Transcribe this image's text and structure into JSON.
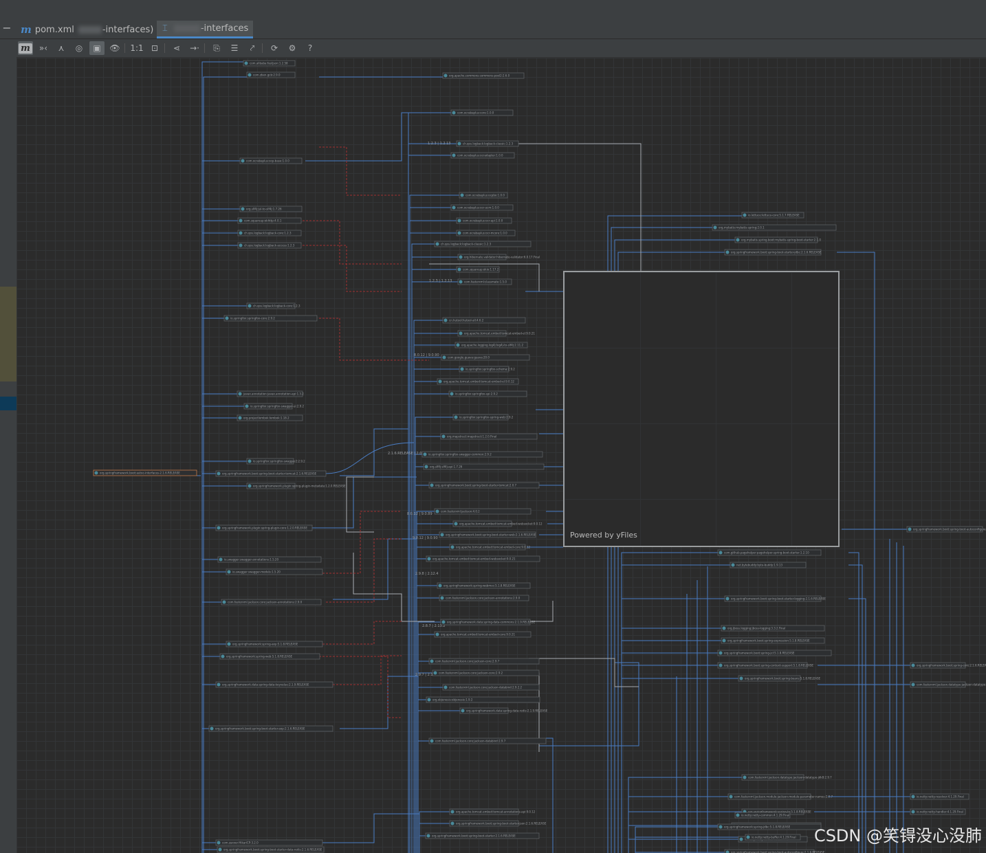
{
  "tabs": [
    {
      "label": "pom.xml",
      "label_suffix": "-interfaces)",
      "icon": "maven-m-icon"
    },
    {
      "label": "-interfaces",
      "icon": "diagram-icon"
    }
  ],
  "toolbar": [
    {
      "name": "show-maven-button",
      "icon": "m",
      "active": true
    },
    {
      "name": "collapse-button",
      "icon": "»‹"
    },
    {
      "name": "hierarchy-button",
      "icon": "⋏"
    },
    {
      "name": "highlight-button",
      "icon": "◎"
    },
    {
      "name": "fit-content-button",
      "icon": "▣",
      "active": true
    },
    {
      "name": "show-button",
      "icon": "👁"
    },
    {
      "name": "actual-size-button",
      "icon": "1:1"
    },
    {
      "name": "fit-window-button",
      "icon": "⊡"
    },
    {
      "name": "layout-button",
      "icon": "⋖"
    },
    {
      "name": "route-edges-button",
      "icon": "→·"
    },
    {
      "name": "copy-button",
      "icon": "⎘"
    },
    {
      "name": "edit-button",
      "icon": "☰"
    },
    {
      "name": "export-button",
      "icon": "⤤"
    },
    {
      "name": "refresh-button",
      "icon": "⟳"
    },
    {
      "name": "settings-button",
      "icon": "⚙"
    },
    {
      "name": "help-button",
      "icon": "?"
    }
  ],
  "overview": {
    "powered_by": "Powered by yFiles"
  },
  "edge_labels": [
    "1.2.3 | 1.2.13",
    "1.2.3 | 1.2.13",
    "8.0.12 | 9.0.90",
    "2.1.6.RELEASE | 2.0.7",
    "8.0.12 | 9.0.89",
    "9.0.12 | 9.0.90",
    "2.9.8 | 2.12.4",
    "2.8.7 | 2.13.2",
    "2.9.7 | 2.12.2"
  ],
  "nodes": [
    {
      "id": "root",
      "label": "org.springframework.boot:autoc-interfaces-2.1.6.RELEASE",
      "root": true
    },
    {
      "id": "n1",
      "label": "com.alibaba:fastjson:1.2.58"
    },
    {
      "id": "n2",
      "label": "com.zben.gcb:2.9.0"
    },
    {
      "id": "n3",
      "label": "org.apache.commons:commons-pool2:2.6.0"
    },
    {
      "id": "n4",
      "label": "com.ocrabaplus:ocp-base:1.0.0"
    },
    {
      "id": "n5",
      "label": "com.ocrabaplus:core:1.0.0"
    },
    {
      "id": "n6",
      "label": "ch.qos.logback:logback-classic:1.2.3"
    },
    {
      "id": "n7",
      "label": "com.ocrabaplus:ocradapter:1.0.0"
    },
    {
      "id": "n8",
      "label": "com.ocrabaplus:ocpbo:1.0.0"
    },
    {
      "id": "n9",
      "label": "org.slf4j:jul-to-slf4j:1.7.26"
    },
    {
      "id": "n10",
      "label": "com.ocrabaplus:ocr-ucm:1.0.0"
    },
    {
      "id": "n11",
      "label": "com.ocrabaplus:ocr-api:1.0.0"
    },
    {
      "id": "n12",
      "label": "com.ocrabaplus:ocr-mcore:1.0.0"
    },
    {
      "id": "n13",
      "label": "com.squareup:okhttp:4.0.1"
    },
    {
      "id": "n14",
      "label": "ch.qos.logback:logback-core:1.2.3"
    },
    {
      "id": "n15",
      "label": "ch.qos.logback:logback-access:1.2.3"
    },
    {
      "id": "n16",
      "label": "ch.qos.logback:logback-classic:1.2.3"
    },
    {
      "id": "n17",
      "label": "org.hibernate.validator:hibernate-validator:6.0.17.Final"
    },
    {
      "id": "n18",
      "label": "com.squareup:okio:1.17.2"
    },
    {
      "id": "n19",
      "label": "com.fasterxml:classmate:1.5.0"
    },
    {
      "id": "n20",
      "label": "ch.qos.logback:logback-core:1.2.3"
    },
    {
      "id": "n21",
      "label": "io.springfox:springfox-core:2.9.2"
    },
    {
      "id": "n22",
      "label": "cn.hutool:hutool-all:4.6.2"
    },
    {
      "id": "n23",
      "label": "org.apache.tomcat.embed:tomcat-embed-el:9.0.21"
    },
    {
      "id": "n24",
      "label": "org.apache.logging.log4j:log4j-to-slf4j:2.11.2"
    },
    {
      "id": "n25",
      "label": "com.google.guava:guava:20.0"
    },
    {
      "id": "n26",
      "label": "io.springfox:springfox-schema:2.9.2"
    },
    {
      "id": "n27",
      "label": "org.apache.tomcat.embed:tomcat-embed-el:9.0.12"
    },
    {
      "id": "n28",
      "label": "io.springfox:springfox-spi:2.9.2"
    },
    {
      "id": "n29",
      "label": "javax.annotation:javax.annotation-api:1.3.2"
    },
    {
      "id": "n30",
      "label": "io.springfox:springfox-swagger-ui:2.9.2"
    },
    {
      "id": "n31",
      "label": "io.springfox:springfox-spring-web:2.9.2"
    },
    {
      "id": "n32",
      "label": "org.projectlombok:lombok:1.18.2"
    },
    {
      "id": "n33",
      "label": "org.mapstruct:mapstruct:1.2.0.Final"
    },
    {
      "id": "n34",
      "label": "io.springfox:springfox-swagger2:2.9.2"
    },
    {
      "id": "n35",
      "label": "io.springfox:springfox-swagger-common:2.9.2"
    },
    {
      "id": "n36",
      "label": "org.slf4j:slf4j-api:1.7.26"
    },
    {
      "id": "n37",
      "label": "org.springframework.boot:spring-boot-starter-tomcat:2.1.6.RELEASE"
    },
    {
      "id": "n38",
      "label": "org.springframework.plugin:spring-plugin-metadata:1.2.0.RELEASE"
    },
    {
      "id": "n39",
      "label": "org.springframework.boot:spring-boot-starter-tomcat:2.0.7"
    },
    {
      "id": "n40",
      "label": "com.fasterxml:jackson:4.0.2"
    },
    {
      "id": "n41",
      "label": "org.springframework.plugin:spring-plugin-core:1.2.0.RELEASE"
    },
    {
      "id": "n42",
      "label": "org.apache.tomcat.embed:tomcat-embed-websocket:9.0.12"
    },
    {
      "id": "n43",
      "label": "io.swagger:swagger-annotations:1.5.20"
    },
    {
      "id": "n44",
      "label": "org.springframework.boot:spring-boot-starter-web:2.1.6.RELEASE"
    },
    {
      "id": "n45",
      "label": "org.apache.tomcat.embed:tomcat-embed-core:9.0.12"
    },
    {
      "id": "n46",
      "label": "io.swagger:swagger-models:1.5.20"
    },
    {
      "id": "n47",
      "label": "org.apache.tomcat.embed:tomcat-embed-websocket:9.0.21"
    },
    {
      "id": "n48",
      "label": "org.springframework:spring-webmvc:5.1.8.RELEASE"
    },
    {
      "id": "n49",
      "label": "com.fasterxml.jackson.core:jackson-annotations:2.9.0"
    },
    {
      "id": "n50",
      "label": "com.fasterxml.jackson.core:jackson-annotations:2.9.0"
    },
    {
      "id": "n51",
      "label": "org.springframework.data:spring-data-commons:2.1.9.RELEASE"
    },
    {
      "id": "n52",
      "label": "org.apache.tomcat.embed:tomcat-embed-core:9.0.21"
    },
    {
      "id": "n53",
      "label": "org.springframework:spring-aop:5.1.8.RELEASE"
    },
    {
      "id": "n54",
      "label": "org.springframework:spring-web:5.1.8.RELEASE"
    },
    {
      "id": "n55",
      "label": "com.fasterxml.jackson.core:jackson-core:2.9.7"
    },
    {
      "id": "n56",
      "label": "com.fasterxml.jackson.core:jackson-core:2.9.2"
    },
    {
      "id": "n57",
      "label": "org.springframework.data:spring-data-keyvalue:2.1.9.RELEASE"
    },
    {
      "id": "n58",
      "label": "com.fasterxml.jackson.core:jackson-databind:2.9.2.2"
    },
    {
      "id": "n59",
      "label": "org.objenesis:objenesis:1.9.2"
    },
    {
      "id": "n60",
      "label": "org.springframework.data:spring-data-redis:2.1.9.RELEASE"
    },
    {
      "id": "n61",
      "label": "org.springframework.boot:spring-boot-starter-aop:2.1.6.RELEASE"
    },
    {
      "id": "n62",
      "label": "com.fasterxml.jackson.core:jackson-databind:2.9.7"
    },
    {
      "id": "n63",
      "label": "org.apache.tomcat.embed:tomcat-annotations-api:9.0.12"
    },
    {
      "id": "n64",
      "label": "org.springframework.boot:spring-boot-starter-json:2.1.6.RELEASE"
    },
    {
      "id": "n65",
      "label": "com.zaxxer:HikariCP:3.2.0"
    },
    {
      "id": "n66",
      "label": "org.springframework.boot:spring-boot-starter-data-redis:2.1.6.RELEASE"
    },
    {
      "id": "n67",
      "label": "org.springframework.boot:spring-boot-starter:2.1.6.RELEASE"
    },
    {
      "id": "n68",
      "label": "io.lettuce:lettuce-core:5.1.7.RELEASE"
    },
    {
      "id": "n69",
      "label": "org.mybatis:mybatis-spring:2.0.1"
    },
    {
      "id": "n70",
      "label": "org.mybatis.spring.boot:mybatis-spring-boot-starter:2.1.0"
    },
    {
      "id": "n71",
      "label": "org.springframework.boot:spring-boot-starter-jdbc:2.1.6.RELEASE"
    },
    {
      "id": "n72",
      "label": "com.github.pagehelper:pagehelper-spring-boot-starter:1.2.10"
    },
    {
      "id": "n73",
      "label": "net.bytebuddy:byte-buddy:1.9.13"
    },
    {
      "id": "n74",
      "label": "org.springframework.boot:spring-boot-starter-logging:2.1.6.RELEASE"
    },
    {
      "id": "n75",
      "label": "org.jboss.logging:jboss-logging:3.3.2.Final"
    },
    {
      "id": "n76",
      "label": "org.springframework.boot:spring-expression:5.1.8.RELEASE"
    },
    {
      "id": "n77",
      "label": "org.springframework.boot:spring-jcl:5.1.8.RELEASE"
    },
    {
      "id": "n78",
      "label": "org.springframework.boot:spring-context-support:5.1.8.RELEASE"
    },
    {
      "id": "n79",
      "label": "org.springframework.boot:spring-beans:5.1.8.RELEASE"
    },
    {
      "id": "n80",
      "label": "org.springframework.boot:spring-boot-autoconfigure:2.1.6.RELEASE"
    },
    {
      "id": "n81",
      "label": "org.springframework.boot:spring-core:2.1.6.RELEASE"
    },
    {
      "id": "n82",
      "label": "com.fasterxml.jackson.datatype:jackson-datatype-jsr310:2.9.7"
    },
    {
      "id": "n83",
      "label": "com.fasterxml.jackson.datatype:jackson-datatype-jdk8:2.9.7"
    },
    {
      "id": "n84",
      "label": "com.fasterxml.jackson.module:jackson-module-parameter-names:2.9.7"
    },
    {
      "id": "n85",
      "label": "org.springframework:spring-tx:5.1.8.RELEASE"
    },
    {
      "id": "n86",
      "label": "io.netty:netty-transport:4.1.29.Final"
    },
    {
      "id": "n87",
      "label": "io.netty:netty-codec:4.1.29.Final"
    },
    {
      "id": "n88",
      "label": "io.netty:netty-resolver:4.1.29.Final"
    },
    {
      "id": "n89",
      "label": "io.netty:netty-common:4.1.29.Final"
    },
    {
      "id": "n90",
      "label": "org.springframework:spring-jdbc:5.1.8.RELEASE"
    },
    {
      "id": "n91",
      "label": "io.netty:netty-handler:4.1.29.Final"
    },
    {
      "id": "n92",
      "label": "io.netty:netty-buffer:4.1.29.Final"
    },
    {
      "id": "n93",
      "label": "org.springframework.boot:spring-boot-autoconfigure:2.1.6.RELEASE"
    },
    {
      "id": "n94",
      "label": "javax.annotation:javax.annotation-api:1.3.2"
    },
    {
      "id": "n95",
      "label": "org.springframework:spring-jcl:5.1.8.RELEASE"
    }
  ],
  "watermark": "CSDN @笑锝没心没肺"
}
